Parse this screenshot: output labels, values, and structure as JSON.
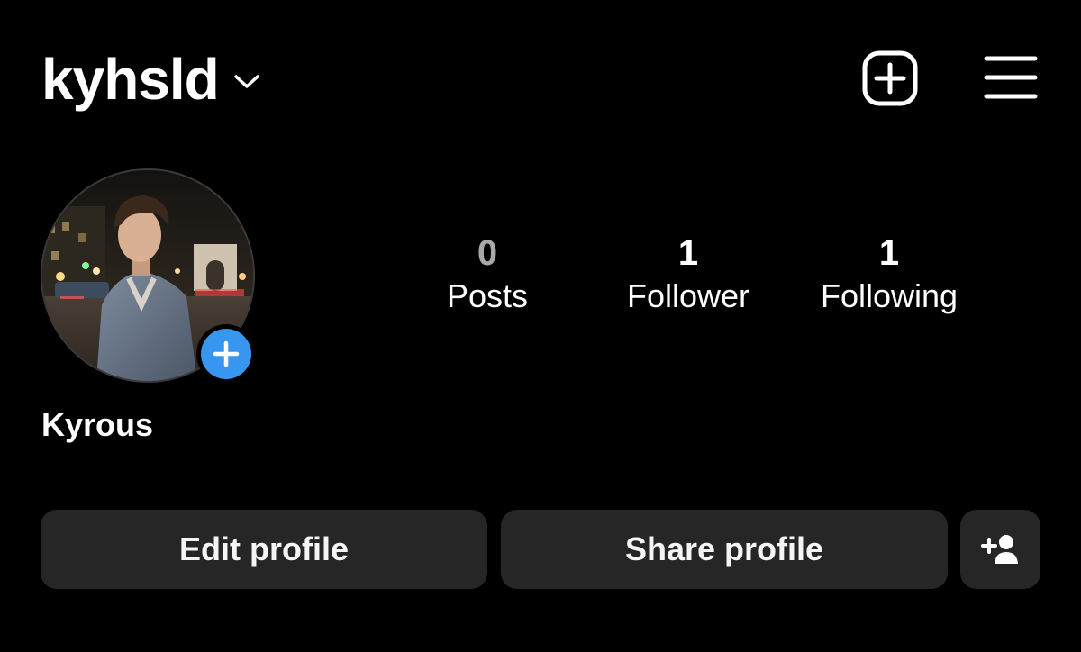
{
  "header": {
    "username": "kyhsld",
    "icons": {
      "dropdown": "chevron-down-icon",
      "new_post": "plus-square-icon",
      "menu": "hamburger-menu-icon"
    }
  },
  "profile": {
    "full_name": "Kyrous",
    "avatar": "profile-photo-man-at-night-street",
    "add_story_icon": "plus-icon"
  },
  "stats": [
    {
      "count": "0",
      "label": "Posts"
    },
    {
      "count": "1",
      "label": "Follower"
    },
    {
      "count": "1",
      "label": "Following"
    }
  ],
  "actions": {
    "edit_profile": "Edit profile",
    "share_profile": "Share profile",
    "discover_people_icon": "add-person-icon"
  },
  "colors": {
    "background": "#000000",
    "button": "#262626",
    "accent": "#3797f0",
    "dim_text": "#a8a8a8"
  }
}
